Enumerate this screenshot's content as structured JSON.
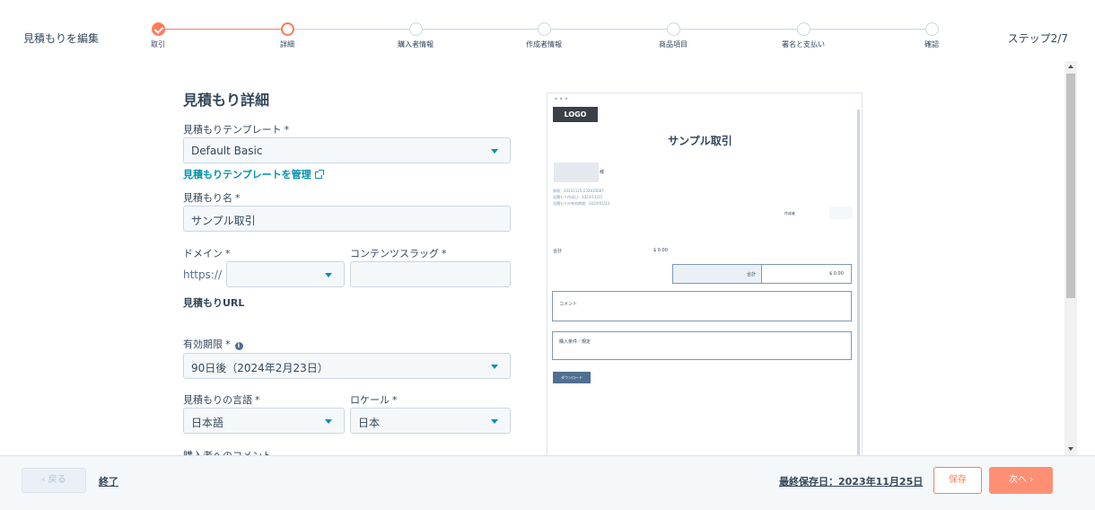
{
  "header": {
    "title": "見積もりを編集",
    "step_indicator": "ステップ2/7"
  },
  "steps": [
    {
      "label": "取引",
      "state": "done"
    },
    {
      "label": "詳細",
      "state": "current"
    },
    {
      "label": "購入者情報",
      "state": "todo"
    },
    {
      "label": "作成者情報",
      "state": "todo"
    },
    {
      "label": "商品項目",
      "state": "todo"
    },
    {
      "label": "署名と支払い",
      "state": "todo"
    },
    {
      "label": "確認",
      "state": "todo"
    }
  ],
  "form": {
    "section_title": "見積もり詳細",
    "template_label": "見積もりテンプレート",
    "template_value": "Default Basic",
    "manage_template_link": "見積もりテンプレートを管理",
    "name_label": "見積もり名",
    "name_value": "サンプル取引",
    "domain_label": "ドメイン",
    "domain_prefix": "https://",
    "slug_label": "コンテンツスラッグ",
    "url_label": "見積もりURL",
    "expiry_label": "有効期限",
    "expiry_value": "90日後（2024年2月23日）",
    "language_label": "見積もりの言語",
    "language_value": "日本語",
    "locale_label": "ロケール",
    "locale_value": "日本",
    "buyer_comment_label": "購入者へのコメント",
    "required_mark": "*",
    "info_glyph": "i"
  },
  "preview": {
    "dots": "•••",
    "logo": "LOGO",
    "title": "サンプル取引",
    "recipient_suffix": "様",
    "ref_line": "参照：20231125-232830687",
    "created_line": "見積もり作成日：2023/11/25",
    "expiry_line": "見積もりの有効期限：2024/02/23",
    "creator_label": "作成者",
    "subtotal_label": "合計",
    "subtotal_value": "$ 0.00",
    "total_label": "合計",
    "total_value": "$ 0.00",
    "comment_label": "コメント",
    "terms_label": "購入条件／規定",
    "download_button": "ダウンロード"
  },
  "footer": {
    "back_button": "‹  戻る",
    "exit_link": "終了",
    "last_saved": "最終保存日：2023年11月25日",
    "save_button": "保存",
    "next_button": "次へ  ›"
  },
  "colors": {
    "accent": "#ff7a59",
    "link": "#0091ae",
    "text": "#33475b",
    "border": "#cbd6e2"
  },
  "icons": {
    "done_step": "check-icon",
    "external": "external-link-icon",
    "info": "info-icon",
    "dropdown": "caret-down-icon"
  }
}
